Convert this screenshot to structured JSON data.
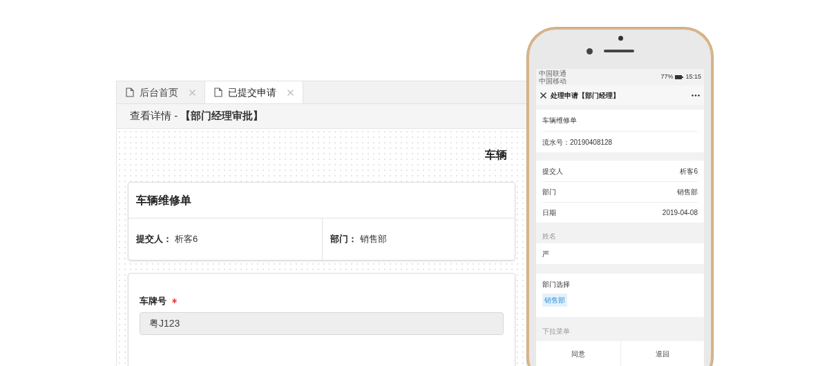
{
  "desktop": {
    "tabs": [
      {
        "label": "后台首页",
        "selected": false
      },
      {
        "label": "已提交申请",
        "selected": true
      }
    ],
    "heading": "查看详情 - **【部门经理审批】**",
    "form_title": "车辆",
    "card": {
      "title": "车辆维修单",
      "fields": [
        {
          "label": "提交人：",
          "value": "析客6"
        },
        {
          "label": "部门：",
          "value": "销售部"
        }
      ]
    },
    "field": {
      "label": "车牌号",
      "required": true,
      "value": "粤J123"
    }
  },
  "phone": {
    "status_bar": {
      "carriers": [
        "中国联通",
        "中国移动"
      ],
      "battery": "77%",
      "time": "15:15"
    },
    "title": "处理申请【部门经理】",
    "header_rows": [
      "车辆维修单",
      "流水号：20190408128"
    ],
    "info_rows": [
      {
        "label": "提交人",
        "value": "析客6"
      },
      {
        "label": "部门",
        "value": "销售部"
      },
      {
        "label": "日期",
        "value": "2019-04-08"
      }
    ],
    "name_field": {
      "label": "姓名",
      "value": "严"
    },
    "department_select": {
      "label": "部门选择",
      "tag": "销售部"
    },
    "dropdown_label": "下拉菜单",
    "buttons": [
      "同意",
      "退回"
    ]
  }
}
